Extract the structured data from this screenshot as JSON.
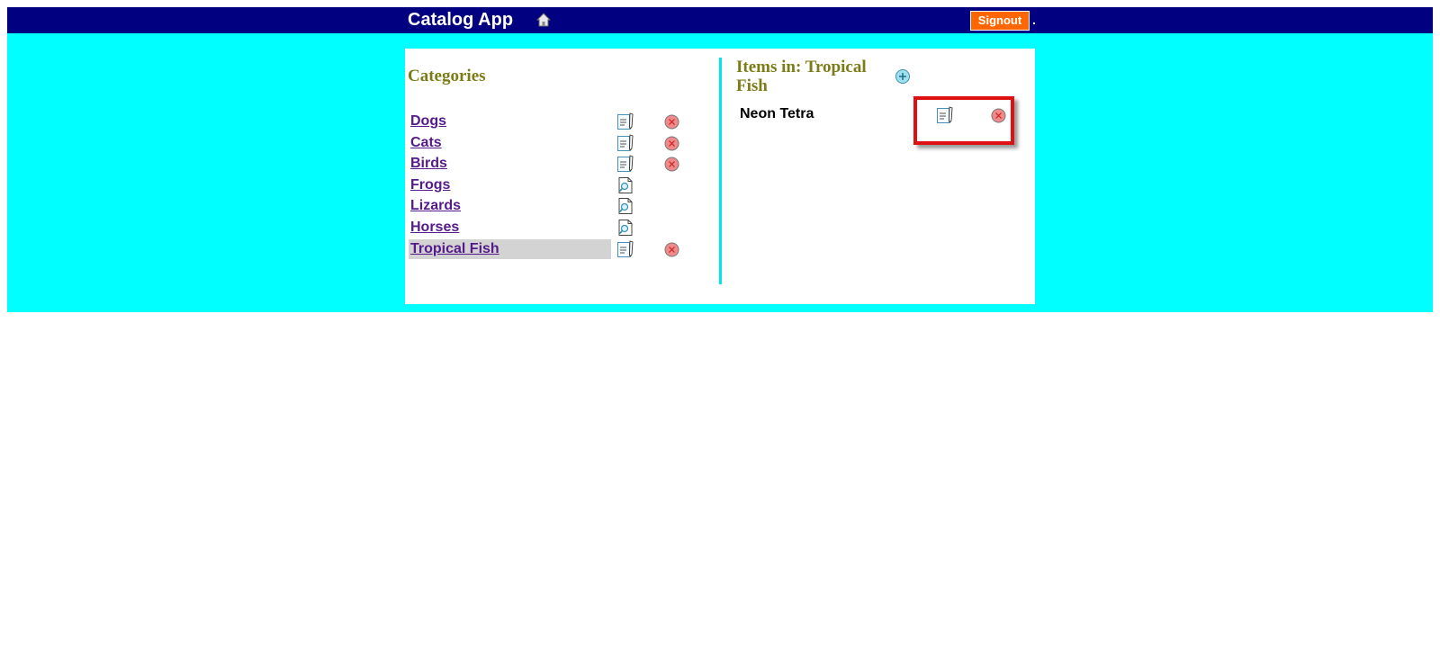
{
  "header": {
    "app_title": "Catalog App",
    "home_icon": "home-icon",
    "signout_label": "Signout",
    "trailing_text": "."
  },
  "categories": {
    "heading": "Categories",
    "items": [
      {
        "name": "Dogs",
        "icon1": "edit-icon",
        "icon2": "delete-icon"
      },
      {
        "name": "Cats",
        "icon1": "edit-icon",
        "icon2": "delete-icon"
      },
      {
        "name": "Birds",
        "icon1": "edit-icon",
        "icon2": "delete-icon"
      },
      {
        "name": "Frogs",
        "icon1": "view-icon",
        "icon2": null
      },
      {
        "name": "Lizards",
        "icon1": "view-icon",
        "icon2": null
      },
      {
        "name": "Horses",
        "icon1": "view-icon",
        "icon2": null
      },
      {
        "name": "Tropical Fish",
        "icon1": "edit-icon",
        "icon2": "delete-icon",
        "selected": true
      }
    ]
  },
  "items": {
    "heading": "Items in: Tropical Fish",
    "add_icon": "add-icon",
    "list": [
      {
        "name": "Neon Tetra",
        "icon1": "edit-icon",
        "icon2": "delete-icon"
      }
    ]
  },
  "colors": {
    "background": "#00ffff",
    "topbar": "#000080",
    "signout": "#ff6600",
    "heading": "#7b7b17",
    "link": "#551a8b",
    "selected_row": "#d3d3d3",
    "highlight": "#dd1111"
  }
}
